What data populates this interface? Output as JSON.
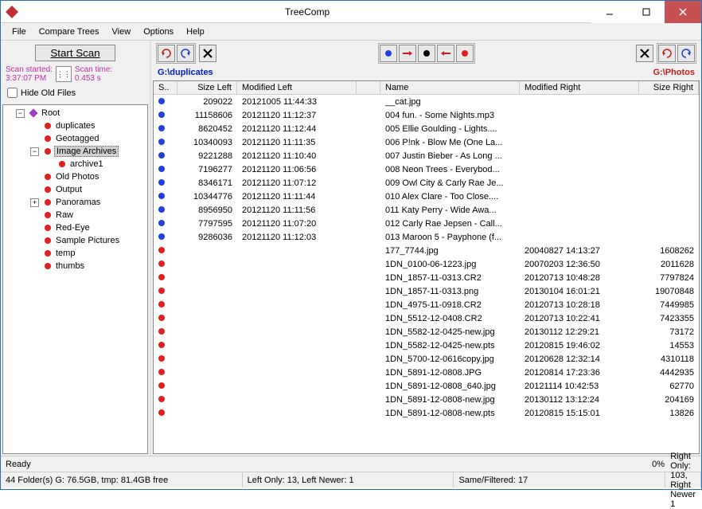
{
  "window": {
    "title": "TreeComp"
  },
  "menu": {
    "file": "File",
    "compare": "Compare Trees",
    "view": "View",
    "options": "Options",
    "help": "Help"
  },
  "scan": {
    "button": "Start Scan",
    "started_label": "Scan started:",
    "started_value": "3:37:07 PM",
    "time_label": "Scan time:",
    "time_value": "0.453 s",
    "hide_label": "Hide Old Files"
  },
  "tree": {
    "root": "Root",
    "items": [
      {
        "label": "duplicates",
        "expand": null,
        "indent": 2,
        "color": "red"
      },
      {
        "label": "Geotagged",
        "expand": null,
        "indent": 2,
        "color": "red"
      },
      {
        "label": "Image Archives",
        "expand": "-",
        "indent": 2,
        "color": "red",
        "selected": true
      },
      {
        "label": "archive1",
        "expand": null,
        "indent": 3,
        "color": "red"
      },
      {
        "label": "Old Photos",
        "expand": null,
        "indent": 2,
        "color": "red"
      },
      {
        "label": "Output",
        "expand": null,
        "indent": 2,
        "color": "red"
      },
      {
        "label": "Panoramas",
        "expand": "+",
        "indent": 2,
        "color": "red"
      },
      {
        "label": "Raw",
        "expand": null,
        "indent": 2,
        "color": "red"
      },
      {
        "label": "Red-Eye",
        "expand": null,
        "indent": 2,
        "color": "red"
      },
      {
        "label": "Sample Pictures",
        "expand": null,
        "indent": 2,
        "color": "red"
      },
      {
        "label": "temp",
        "expand": null,
        "indent": 2,
        "color": "red"
      },
      {
        "label": "thumbs",
        "expand": null,
        "indent": 2,
        "color": "red"
      }
    ]
  },
  "paths": {
    "left": "G:\\duplicates",
    "right": "G:\\Photos"
  },
  "columns": {
    "s": "S..",
    "size_left": "Size Left",
    "mod_left": "Modified Left",
    "name": "Name",
    "mod_right": "Modified Right",
    "size_right": "Size Right"
  },
  "rows": [
    {
      "dot": "blue",
      "size_left": "209022",
      "mod_left": "20121005 11:44:33",
      "name": "__cat.jpg",
      "mod_right": "",
      "size_right": ""
    },
    {
      "dot": "blue",
      "size_left": "11158606",
      "mod_left": "20121120 11:12:37",
      "name": "004 fun. - Some Nights.mp3",
      "mod_right": "",
      "size_right": ""
    },
    {
      "dot": "blue",
      "size_left": "8620452",
      "mod_left": "20121120 11:12:44",
      "name": "005 Ellie Goulding - Lights....",
      "mod_right": "",
      "size_right": ""
    },
    {
      "dot": "blue",
      "size_left": "10340093",
      "mod_left": "20121120 11:11:35",
      "name": "006 P!nk - Blow Me (One La...",
      "mod_right": "",
      "size_right": ""
    },
    {
      "dot": "blue",
      "size_left": "9221288",
      "mod_left": "20121120 11:10:40",
      "name": "007 Justin Bieber - As Long ...",
      "mod_right": "",
      "size_right": ""
    },
    {
      "dot": "blue",
      "size_left": "7196277",
      "mod_left": "20121120 11:06:56",
      "name": "008 Neon Trees - Everybod...",
      "mod_right": "",
      "size_right": ""
    },
    {
      "dot": "blue",
      "size_left": "8346171",
      "mod_left": "20121120 11:07:12",
      "name": "009 Owl City & Carly Rae Je...",
      "mod_right": "",
      "size_right": ""
    },
    {
      "dot": "blue",
      "size_left": "10344776",
      "mod_left": "20121120 11:11:44",
      "name": "010 Alex Clare - Too Close....",
      "mod_right": "",
      "size_right": ""
    },
    {
      "dot": "blue",
      "size_left": "8956950",
      "mod_left": "20121120 11:11:56",
      "name": "011 Katy Perry - Wide Awa...",
      "mod_right": "",
      "size_right": ""
    },
    {
      "dot": "blue",
      "size_left": "7797595",
      "mod_left": "20121120 11:07:20",
      "name": "012 Carly Rae Jepsen - Call...",
      "mod_right": "",
      "size_right": ""
    },
    {
      "dot": "blue",
      "size_left": "9286036",
      "mod_left": "20121120 11:12:03",
      "name": "013 Maroon 5 - Payphone (f...",
      "mod_right": "",
      "size_right": ""
    },
    {
      "dot": "red",
      "size_left": "",
      "mod_left": "",
      "name": "177_7744.jpg",
      "mod_right": "20040827 14:13:27",
      "size_right": "1608262"
    },
    {
      "dot": "red",
      "size_left": "",
      "mod_left": "",
      "name": "1DN_0100-06-1223.jpg",
      "mod_right": "20070203 12:36:50",
      "size_right": "2011628"
    },
    {
      "dot": "red",
      "size_left": "",
      "mod_left": "",
      "name": "1DN_1857-11-0313.CR2",
      "mod_right": "20120713 10:48:28",
      "size_right": "7797824"
    },
    {
      "dot": "red",
      "size_left": "",
      "mod_left": "",
      "name": "1DN_1857-11-0313.png",
      "mod_right": "20130104 16:01:21",
      "size_right": "19070848"
    },
    {
      "dot": "red",
      "size_left": "",
      "mod_left": "",
      "name": "1DN_4975-11-0918.CR2",
      "mod_right": "20120713 10:28:18",
      "size_right": "7449985"
    },
    {
      "dot": "red",
      "size_left": "",
      "mod_left": "",
      "name": "1DN_5512-12-0408.CR2",
      "mod_right": "20120713 10:22:41",
      "size_right": "7423355"
    },
    {
      "dot": "red",
      "size_left": "",
      "mod_left": "",
      "name": "1DN_5582-12-0425-new.jpg",
      "mod_right": "20130112 12:29:21",
      "size_right": "73172"
    },
    {
      "dot": "red",
      "size_left": "",
      "mod_left": "",
      "name": "1DN_5582-12-0425-new.pts",
      "mod_right": "20120815 19:46:02",
      "size_right": "14553"
    },
    {
      "dot": "red",
      "size_left": "",
      "mod_left": "",
      "name": "1DN_5700-12-0616copy.jpg",
      "mod_right": "20120628 12:32:14",
      "size_right": "4310118"
    },
    {
      "dot": "red",
      "size_left": "",
      "mod_left": "",
      "name": "1DN_5891-12-0808.JPG",
      "mod_right": "20120814 17:23:36",
      "size_right": "4442935"
    },
    {
      "dot": "red",
      "size_left": "",
      "mod_left": "",
      "name": "1DN_5891-12-0808_640.jpg",
      "mod_right": "20121114 10:42:53",
      "size_right": "62770"
    },
    {
      "dot": "red",
      "size_left": "",
      "mod_left": "",
      "name": "1DN_5891-12-0808-new.jpg",
      "mod_right": "20130112 13:12:24",
      "size_right": "204169"
    },
    {
      "dot": "red",
      "size_left": "",
      "mod_left": "",
      "name": "1DN_5891-12-0808-new.pts",
      "mod_right": "20120815 15:15:01",
      "size_right": "13826"
    }
  ],
  "status": {
    "ready": "Ready",
    "progress": "0%",
    "folders": "44 Folder(s) G: 76.5GB, tmp: 81.4GB free",
    "left_stats": "Left Only: 13, Left Newer: 1",
    "same_stats": "Same/Filtered: 17",
    "right_stats": "Right Only: 103, Right Newer 1"
  }
}
